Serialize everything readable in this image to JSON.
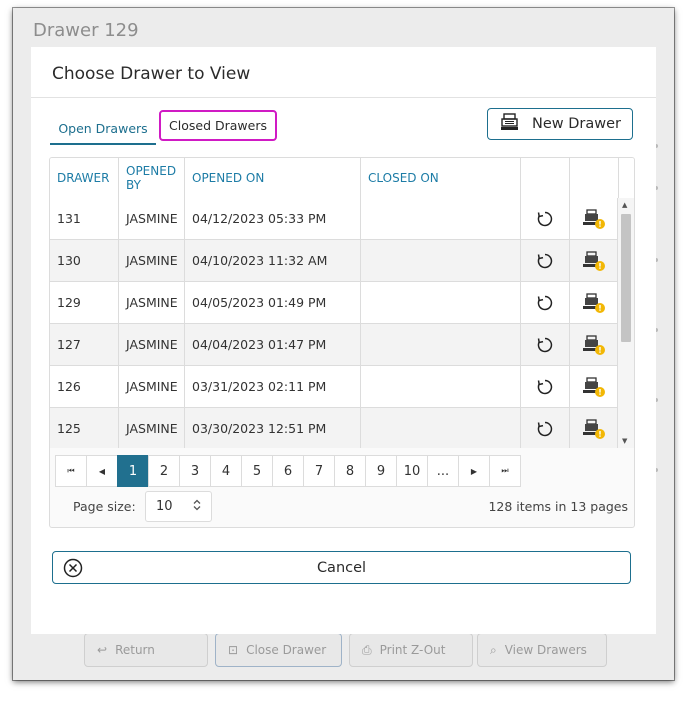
{
  "background": {
    "window_title": "Drawer 129",
    "footer_buttons": [
      {
        "label": "Return",
        "icon": "return-icon"
      },
      {
        "label": "Close Drawer",
        "icon": "close-drawer-icon"
      },
      {
        "label": "Print Z-Out",
        "icon": "printer-icon"
      },
      {
        "label": "View Drawers",
        "icon": "search-icon"
      }
    ]
  },
  "dialog": {
    "title": "Choose Drawer to View",
    "tabs": [
      {
        "label": "Open Drawers",
        "selected": true
      },
      {
        "label": "Closed Drawers",
        "selected": false,
        "highlighted": true
      }
    ],
    "new_drawer_label": "New Drawer",
    "cancel_label": "Cancel"
  },
  "grid": {
    "columns": [
      {
        "key": "drawer",
        "label": "DRAWER"
      },
      {
        "key": "opened_by",
        "label": "OPENED BY"
      },
      {
        "key": "opened_on",
        "label": "OPENED ON"
      },
      {
        "key": "closed_on",
        "label": "CLOSED ON"
      },
      {
        "key": "action1",
        "label": ""
      },
      {
        "key": "action2",
        "label": ""
      }
    ],
    "rows": [
      {
        "drawer": "131",
        "opened_by": "JASMINE",
        "opened_on": "04/12/2023 05:33 PM",
        "closed_on": ""
      },
      {
        "drawer": "130",
        "opened_by": "JASMINE",
        "opened_on": "04/10/2023 11:32 AM",
        "closed_on": ""
      },
      {
        "drawer": "129",
        "opened_by": "JASMINE",
        "opened_on": "04/05/2023 01:49 PM",
        "closed_on": ""
      },
      {
        "drawer": "127",
        "opened_by": "JASMINE",
        "opened_on": "04/04/2023 01:47 PM",
        "closed_on": ""
      },
      {
        "drawer": "126",
        "opened_by": "JASMINE",
        "opened_on": "03/31/2023 02:11 PM",
        "closed_on": ""
      },
      {
        "drawer": "125",
        "opened_by": "JASMINE",
        "opened_on": "03/30/2023 12:51 PM",
        "closed_on": ""
      }
    ],
    "row_icons": [
      "reopen-icon",
      "register-warning-icon"
    ]
  },
  "pager": {
    "first": "⏮",
    "prev": "◀",
    "next": "▶",
    "last": "⏭",
    "pages": [
      "1",
      "2",
      "3",
      "4",
      "5",
      "6",
      "7",
      "8",
      "9",
      "10",
      "..."
    ],
    "current": "1",
    "page_size_label": "Page size:",
    "page_size": "10",
    "info": "128 items in 13 pages"
  },
  "colors": {
    "accent": "#1d6f8e",
    "highlight_border": "#d01ac4",
    "header_text": "#1d7ca6",
    "warning": "#f2b705"
  }
}
